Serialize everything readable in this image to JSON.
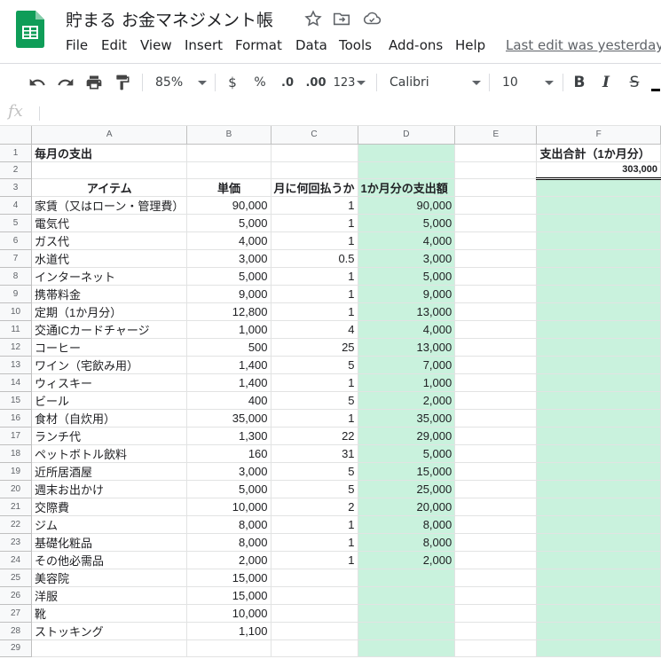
{
  "app": {
    "doc_title": "貯まる お金マネジメント帳",
    "menus": [
      "File",
      "Edit",
      "View",
      "Insert",
      "Format",
      "Data",
      "Tools",
      "Add-ons",
      "Help"
    ],
    "last_edit": "Last edit was yesterday a"
  },
  "toolbar": {
    "zoom": "85%",
    "currency": "$",
    "percent": "%",
    "dec_decrease": ".0",
    "dec_increase": ".00",
    "number_format": "123",
    "font": "Calibri",
    "font_size": "10",
    "bold": "B",
    "italic": "I",
    "strike": "S"
  },
  "formula_bar": {
    "fx": "fx",
    "value": ""
  },
  "sheet": {
    "columns": [
      "A",
      "B",
      "C",
      "D",
      "E",
      "F"
    ],
    "rows": [
      {
        "n": "1",
        "a": "毎月の支出",
        "b": "",
        "c": "",
        "d": "",
        "e": "",
        "f": "支出合計（1か月分）"
      },
      {
        "n": "2",
        "a": "",
        "b": "",
        "c": "",
        "d": "",
        "e": "",
        "f": "303,000"
      },
      {
        "n": "3",
        "a": "アイテム",
        "b": "単価",
        "c": "月に何回払うか",
        "d": "1か月分の支出額",
        "e": "",
        "f": ""
      },
      {
        "n": "4",
        "a": "家賃（又はローン・管理費）",
        "b": "90,000",
        "c": "1",
        "d": "90,000",
        "e": "",
        "f": ""
      },
      {
        "n": "5",
        "a": "電気代",
        "b": "5,000",
        "c": "1",
        "d": "5,000",
        "e": "",
        "f": ""
      },
      {
        "n": "6",
        "a": "ガス代",
        "b": "4,000",
        "c": "1",
        "d": "4,000",
        "e": "",
        "f": ""
      },
      {
        "n": "7",
        "a": "水道代",
        "b": "3,000",
        "c": "0.5",
        "d": "3,000",
        "e": "",
        "f": ""
      },
      {
        "n": "8",
        "a": "インターネット",
        "b": "5,000",
        "c": "1",
        "d": "5,000",
        "e": "",
        "f": ""
      },
      {
        "n": "9",
        "a": "携帯料金",
        "b": "9,000",
        "c": "1",
        "d": "9,000",
        "e": "",
        "f": ""
      },
      {
        "n": "10",
        "a": "定期（1か月分）",
        "b": "12,800",
        "c": "1",
        "d": "13,000",
        "e": "",
        "f": ""
      },
      {
        "n": "11",
        "a": "交通ICカードチャージ",
        "b": "1,000",
        "c": "4",
        "d": "4,000",
        "e": "",
        "f": ""
      },
      {
        "n": "12",
        "a": "コーヒー",
        "b": "500",
        "c": "25",
        "d": "13,000",
        "e": "",
        "f": ""
      },
      {
        "n": "13",
        "a": "ワイン（宅飲み用）",
        "b": "1,400",
        "c": "5",
        "d": "7,000",
        "e": "",
        "f": ""
      },
      {
        "n": "14",
        "a": "ウィスキー",
        "b": "1,400",
        "c": "1",
        "d": "1,000",
        "e": "",
        "f": ""
      },
      {
        "n": "15",
        "a": "ビール",
        "b": "400",
        "c": "5",
        "d": "2,000",
        "e": "",
        "f": ""
      },
      {
        "n": "16",
        "a": "食材（自炊用）",
        "b": "35,000",
        "c": "1",
        "d": "35,000",
        "e": "",
        "f": ""
      },
      {
        "n": "17",
        "a": "ランチ代",
        "b": "1,300",
        "c": "22",
        "d": "29,000",
        "e": "",
        "f": ""
      },
      {
        "n": "18",
        "a": "ペットボトル飲料",
        "b": "160",
        "c": "31",
        "d": "5,000",
        "e": "",
        "f": ""
      },
      {
        "n": "19",
        "a": "近所居酒屋",
        "b": "3,000",
        "c": "5",
        "d": "15,000",
        "e": "",
        "f": ""
      },
      {
        "n": "20",
        "a": "週末お出かけ",
        "b": "5,000",
        "c": "5",
        "d": "25,000",
        "e": "",
        "f": ""
      },
      {
        "n": "21",
        "a": "交際費",
        "b": "10,000",
        "c": "2",
        "d": "20,000",
        "e": "",
        "f": ""
      },
      {
        "n": "22",
        "a": "ジム",
        "b": "8,000",
        "c": "1",
        "d": "8,000",
        "e": "",
        "f": ""
      },
      {
        "n": "23",
        "a": "基礎化粧品",
        "b": "8,000",
        "c": "1",
        "d": "8,000",
        "e": "",
        "f": ""
      },
      {
        "n": "24",
        "a": "その他必需品",
        "b": "2,000",
        "c": "1",
        "d": "2,000",
        "e": "",
        "f": ""
      },
      {
        "n": "25",
        "a": "美容院",
        "b": "15,000",
        "c": "",
        "d": "",
        "e": "",
        "f": ""
      },
      {
        "n": "26",
        "a": "洋服",
        "b": "15,000",
        "c": "",
        "d": "",
        "e": "",
        "f": ""
      },
      {
        "n": "27",
        "a": "靴",
        "b": "10,000",
        "c": "",
        "d": "",
        "e": "",
        "f": ""
      },
      {
        "n": "28",
        "a": "ストッキング",
        "b": "1,100",
        "c": "",
        "d": "",
        "e": "",
        "f": ""
      },
      {
        "n": "29",
        "a": "",
        "b": "",
        "c": "",
        "d": "",
        "e": "",
        "f": ""
      }
    ]
  },
  "colors": {
    "accent_green": "#c9f2dd",
    "sheets_logo": "#0f9d58"
  },
  "icons": [
    "sheets-logo-icon",
    "star-icon",
    "move-folder-icon",
    "cloud-status-icon",
    "undo-icon",
    "redo-icon",
    "print-icon",
    "paint-format-icon"
  ]
}
